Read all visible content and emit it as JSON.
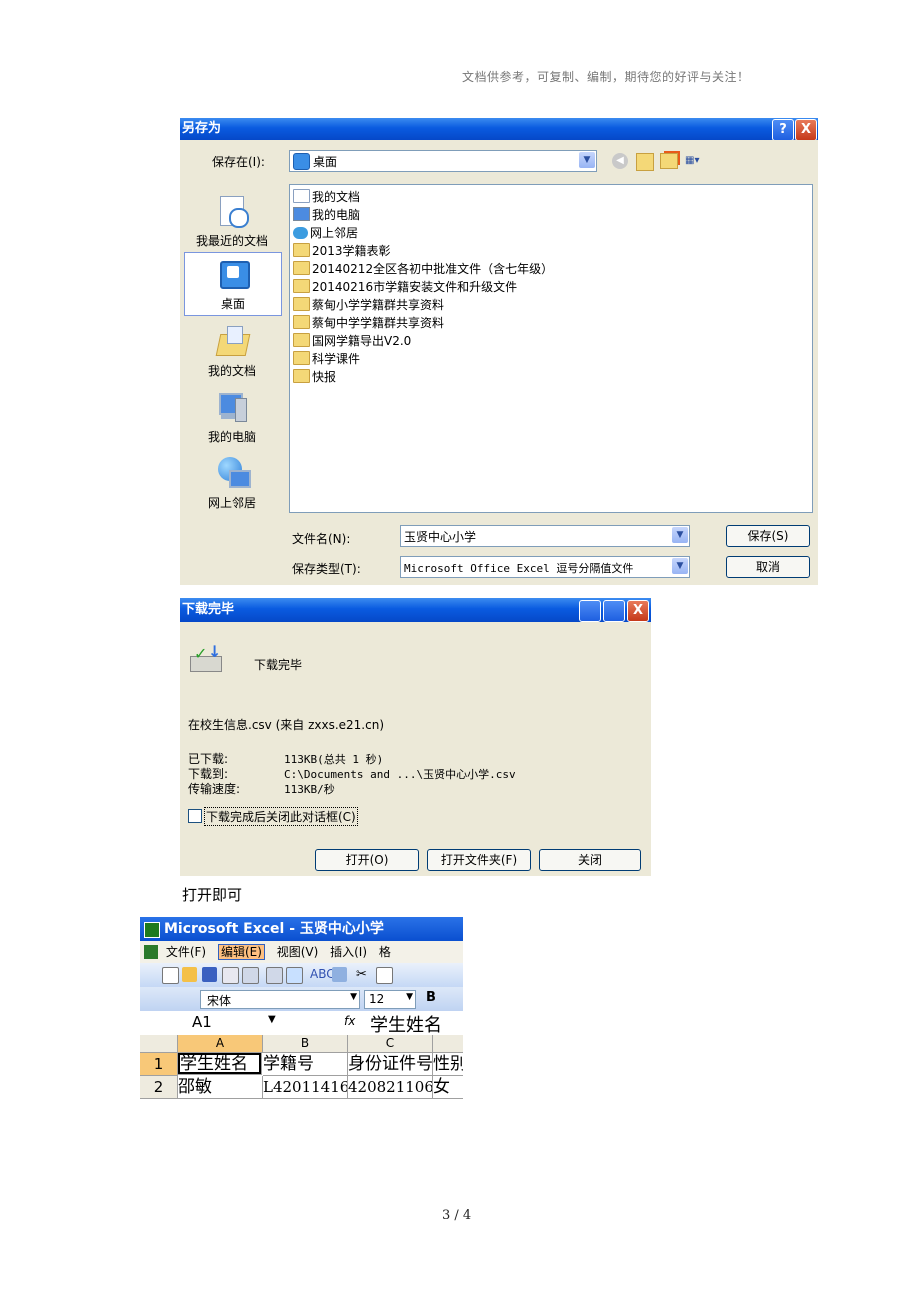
{
  "header_note": "文档供参考，可复制、编制，期待您的好评与关注！",
  "save_dialog": {
    "title": "另存为",
    "help_btn": "?",
    "close_btn": "X",
    "save_in_label": "保存在(I):",
    "save_in_value": "桌面",
    "places": [
      "我最近的文档",
      "桌面",
      "我的文档",
      "我的电脑",
      "网上邻居"
    ],
    "files": [
      {
        "name": "我的文档",
        "icon": "my-documents-icon"
      },
      {
        "name": "我的电脑",
        "icon": "my-computer-icon"
      },
      {
        "name": "网上邻居",
        "icon": "network-icon"
      },
      {
        "name": "2013学籍表彰",
        "icon": "folder-icon"
      },
      {
        "name": "20140212全区各初中批准文件（含七年级）",
        "icon": "folder-icon"
      },
      {
        "name": "20140216市学籍安装文件和升级文件",
        "icon": "folder-icon"
      },
      {
        "name": "蔡甸小学学籍群共享资料",
        "icon": "folder-icon"
      },
      {
        "name": "蔡甸中学学籍群共享资料",
        "icon": "folder-icon"
      },
      {
        "name": "国网学籍导出V2.0",
        "icon": "folder-icon"
      },
      {
        "name": "科学课件",
        "icon": "folder-icon"
      },
      {
        "name": "快报",
        "icon": "folder-icon"
      }
    ],
    "filename_label": "文件名(N):",
    "filename_value": "玉贤中心小学",
    "filetype_label": "保存类型(T):",
    "filetype_value": "Microsoft Office Excel 逗号分隔值文件",
    "save_button": "保存(S)",
    "cancel_button": "取消"
  },
  "download_dialog": {
    "title": "下载完毕",
    "heading": "下载完毕",
    "file_line": "在校生信息.csv (来自 zxxs.e21.cn)",
    "downloaded_label": "已下载:",
    "downloaded_value": "113KB(总共 1 秒)",
    "downloaded_to_label": "下载到:",
    "downloaded_to_value": "C:\\Documents and ...\\玉贤中心小学.csv",
    "speed_label": "传输速度:",
    "speed_value": "113KB/秒",
    "checkbox_label": "下载完成后关闭此对话框(C)",
    "open_button": "打开(O)",
    "open_folder_button": "打开文件夹(F)",
    "close_button": "关闭"
  },
  "caption": "打开即可",
  "excel": {
    "title": "Microsoft Excel - 玉贤中心小学",
    "menu": [
      "文件(F)",
      "编辑(E)",
      "视图(V)",
      "插入(I)",
      "格"
    ],
    "font_name": "宋体",
    "font_size": "12",
    "bold_label": "B",
    "cell_ref": "A1",
    "fx_label": "fx",
    "formula_value": "学生姓名",
    "columns": [
      "A",
      "B",
      "C"
    ],
    "row_numbers": [
      "1",
      "2"
    ],
    "row1": [
      "学生姓名",
      "学籍号",
      "身份证件号",
      "性别"
    ],
    "row2": [
      "邵敏",
      "L42011416",
      "420821106",
      "女"
    ]
  },
  "page_number": "3 / 4"
}
